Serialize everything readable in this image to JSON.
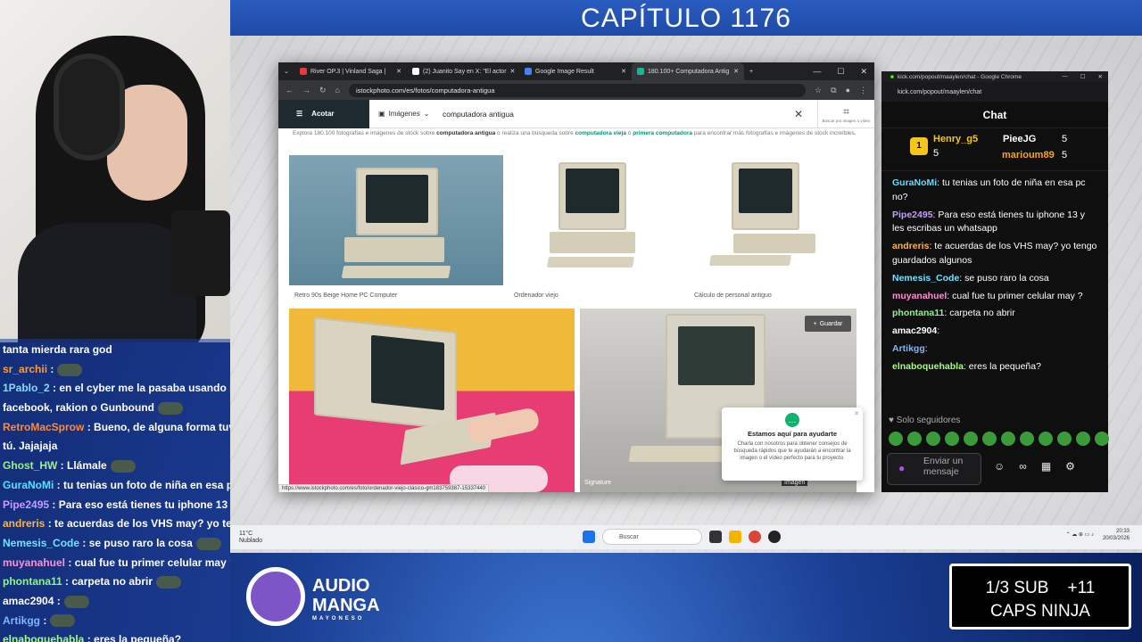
{
  "overlay": {
    "chapter_title": "CAPÍTULO 1176",
    "logo_line1": "AUDIO",
    "logo_line2": "MANGA",
    "logo_line3": "MAYONESO",
    "sub_goal_line1": "1/3 SUB    +11",
    "sub_goal_line2": "CAPS NINJA"
  },
  "left_chat": [
    {
      "user": "",
      "text": "tanta mierda rara god",
      "user_color": "#ffffff"
    },
    {
      "user": "sr_archii",
      "text": " :",
      "user_color": "#ff9c3a",
      "emote": true
    },
    {
      "user": "1Pablo_2",
      "text": " : en el cyber me la pasaba usando key",
      "user_color": "#8ad8ff"
    },
    {
      "user": "",
      "text": "facebook, rakion o Gunbound",
      "user_color": "#ffffff",
      "emote": true
    },
    {
      "user": "RetroMacSprow",
      "text": " : Bueno, de alguna forma tuvie",
      "user_color": "#ff8a3a"
    },
    {
      "user": "",
      "text": "tú. Jajajaja",
      "user_color": "#ffffff"
    },
    {
      "user": "Ghost_HW",
      "text": " : Llámale",
      "user_color": "#9ef08a",
      "emote": true
    },
    {
      "user": "GuraNoMi",
      "text": " : tu tenias un foto de niña en esa pc c",
      "user_color": "#5ae0ff"
    },
    {
      "user": "Pipe2495",
      "text": " : Para eso está tienes tu iphone 13",
      "user_color": "#c59cff"
    },
    {
      "user": "andreris",
      "text": " : te acuerdas de los VHS may? yo teng",
      "user_color": "#ffb347"
    },
    {
      "user": "Nemesis_Code",
      "text": " : se puso raro la cosa",
      "user_color": "#6fe3ff",
      "emote": true
    },
    {
      "user": "muyanahuel",
      "text": " : cual fue tu primer celular may ?",
      "user_color": "#ff8fd2"
    },
    {
      "user": "phontana11",
      "text": " : carpeta no abrir",
      "user_color": "#8ef58e",
      "emote": true
    },
    {
      "user": "amac2904",
      "text": " :",
      "user_color": "#ffffff",
      "emote": true
    },
    {
      "user": "Artikgg",
      "text": " :",
      "user_color": "#7fb5ff",
      "emote": true
    },
    {
      "user": "elnaboquehabla",
      "text": " : eres la pequeña?",
      "user_color": "#a3ff7a"
    }
  ],
  "browser": {
    "tabs": [
      {
        "label": "River OP.3 | Vinland Saga |",
        "active": false,
        "fav": "#e53935"
      },
      {
        "label": "(2) Juanito Say en X: \"El actor",
        "active": false,
        "fav": "#ffffff"
      },
      {
        "label": "Google Image Result",
        "active": false,
        "fav": "#4285f4"
      },
      {
        "label": "180.100+ Computadora Antig",
        "active": true,
        "fav": "#1ab394"
      }
    ],
    "url": "istockphoto.com/es/fotos/computadora-antigua",
    "acotar": "Acotar",
    "image_type": "Imágenes",
    "query": "computadora antigua",
    "camera_hint": "Buscar por imagen o vídeo",
    "intro_prefix": "Explora 180.100 fotografías e imágenes de stock sobre ",
    "intro_bold": "computadora antigua",
    "intro_mid": " o realiza una búsqueda sobre ",
    "intro_link1": "computadora vieja",
    "intro_or": " o ",
    "intro_link2": "primera computadora",
    "intro_suffix": " para encontrar más fotografías e imágenes de stock increíbles.",
    "captions": [
      "Retro 90s Beige Home PC Computer",
      "Ordenador viejo",
      "Cálculo de personal antiguo"
    ],
    "guardar": "Guardar",
    "help_title": "Estamos aquí para ayudarte",
    "help_body": "Charla con nosotros para obtener consejos de búsqueda rápidos que te ayudarán a encontrar la imagen o el vídeo perfecto para tu proyecto.",
    "signature": "Signature",
    "image_tag": "Imagen",
    "status_url": "https://www.istockphoto.com/es/foto/ordenador-viejo-clásico-gm183759387-15337440"
  },
  "kick": {
    "window_title": "kick.com/popout/maaylen/chat - Google Chrome",
    "url": "kick.com/popout/maaylen/chat",
    "header": "Chat",
    "top1_name": "Henry_g5",
    "top1_count": "5",
    "top2_name": "PieeJG",
    "top2_count": "5",
    "top3_name": "marioum89",
    "top3_count": "5",
    "messages": [
      {
        "user": "GuraNoMi",
        "text": ": tu tenias un foto de niña en esa pc no?",
        "color": "#5ae0ff"
      },
      {
        "user": "Pipe2495",
        "text": ": Para eso está tienes tu iphone 13 y les escribas un whatsapp",
        "color": "#c59cff"
      },
      {
        "user": "andreris",
        "text": ": te acuerdas de los VHS may? yo tengo guardados algunos",
        "color": "#ffb347"
      },
      {
        "user": "Nemesis_Code",
        "text": ": se puso raro la cosa",
        "color": "#6fe3ff"
      },
      {
        "user": "muyanahuel",
        "text": ": cual fue tu primer celular may ?",
        "color": "#ff8fd2"
      },
      {
        "user": "phontana11",
        "text": ": carpeta no abrir",
        "color": "#8ef58e"
      },
      {
        "user": "amac2904",
        "text": ":",
        "color": "#ffffff"
      },
      {
        "user": "Artikgg",
        "text": ":",
        "color": "#7fb5ff"
      },
      {
        "user": "elnaboquehabla",
        "text": ": eres la pequeña?",
        "color": "#a3ff7a"
      }
    ],
    "followers_only": "Solo seguidores",
    "input_placeholder": "Enviar un mensaje"
  },
  "taskbar": {
    "temp": "11°C",
    "weather": "Nublado",
    "search": "Buscar",
    "time": "20:33",
    "date": "20/03/2026"
  }
}
